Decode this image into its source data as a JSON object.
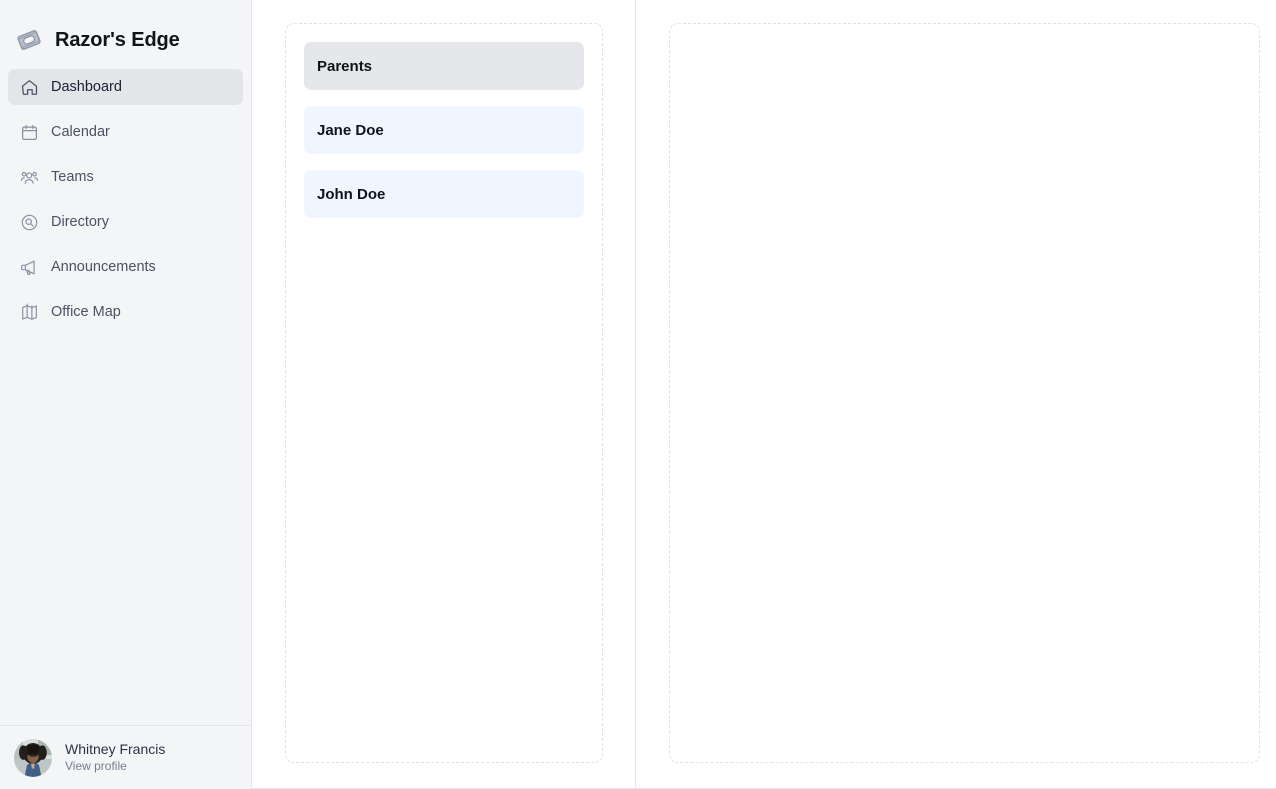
{
  "sidebar": {
    "brand": {
      "title": "Razor's Edge",
      "logo_icon": "razor-blade-icon"
    },
    "items": [
      {
        "label": "Dashboard",
        "icon": "home-icon",
        "active": true
      },
      {
        "label": "Calendar",
        "icon": "calendar-icon",
        "active": false
      },
      {
        "label": "Teams",
        "icon": "users-group-icon",
        "active": false
      },
      {
        "label": "Directory",
        "icon": "search-circle-icon",
        "active": false
      },
      {
        "label": "Announcements",
        "icon": "megaphone-icon",
        "active": false
      },
      {
        "label": "Office Map",
        "icon": "map-icon",
        "active": false
      }
    ],
    "profile": {
      "name": "Whitney Francis",
      "link_label": "View profile",
      "avatar_icon": "avatar"
    }
  },
  "main": {
    "left_panel": {
      "cards": [
        {
          "label": "Parents",
          "kind": "group"
        },
        {
          "label": "Jane Doe",
          "kind": "person"
        },
        {
          "label": "John Doe",
          "kind": "person"
        }
      ]
    },
    "right_panel": {
      "cards": []
    }
  },
  "colors": {
    "sidebar_bg": "#f4f5f7",
    "active_item_bg": "#e3e5e9",
    "group_card_bg": "#e5e7eb",
    "person_card_bg": "#eff6ff",
    "dashed_border": "#dfe1e7",
    "divider": "#e4e6ea",
    "text_primary": "#111318",
    "text_muted": "#777e8e"
  }
}
